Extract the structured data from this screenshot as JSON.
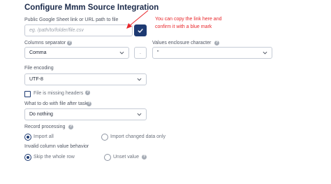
{
  "title": "Configure Mmm Source Integration",
  "sheet": {
    "label": "Public Google Sheet link or URL path to file",
    "placeholder": "eg. /path/to/folder/file.csv",
    "confirm_icon": "checkmark-icon"
  },
  "annotation": {
    "line1": "You can copy the link here and",
    "line2": "confirm it with a blue mark",
    "color": "#e8262a"
  },
  "columns_separator": {
    "label": "Columns separator",
    "value": "Comma",
    "side_value": "."
  },
  "enclosure": {
    "label": "Values enclosure character",
    "value": "\""
  },
  "file_encoding": {
    "label": "File encoding",
    "value": "UTF-8"
  },
  "missing_headers": {
    "label": "File is missing headers",
    "checked": false
  },
  "after_task": {
    "label": "What to do with file after task",
    "value": "Do nothing"
  },
  "record_processing": {
    "label": "Record processing",
    "options": [
      "Import all",
      "Import changed data only"
    ],
    "selected": 0
  },
  "invalid_behavior": {
    "label": "Invalid column value behavior",
    "options": [
      "Skip the whole row",
      "Unset value"
    ],
    "selected": 0
  },
  "colors": {
    "accent": "#1d3a72",
    "border": "#c6ccd6",
    "help_icon": "#a7adb6"
  }
}
